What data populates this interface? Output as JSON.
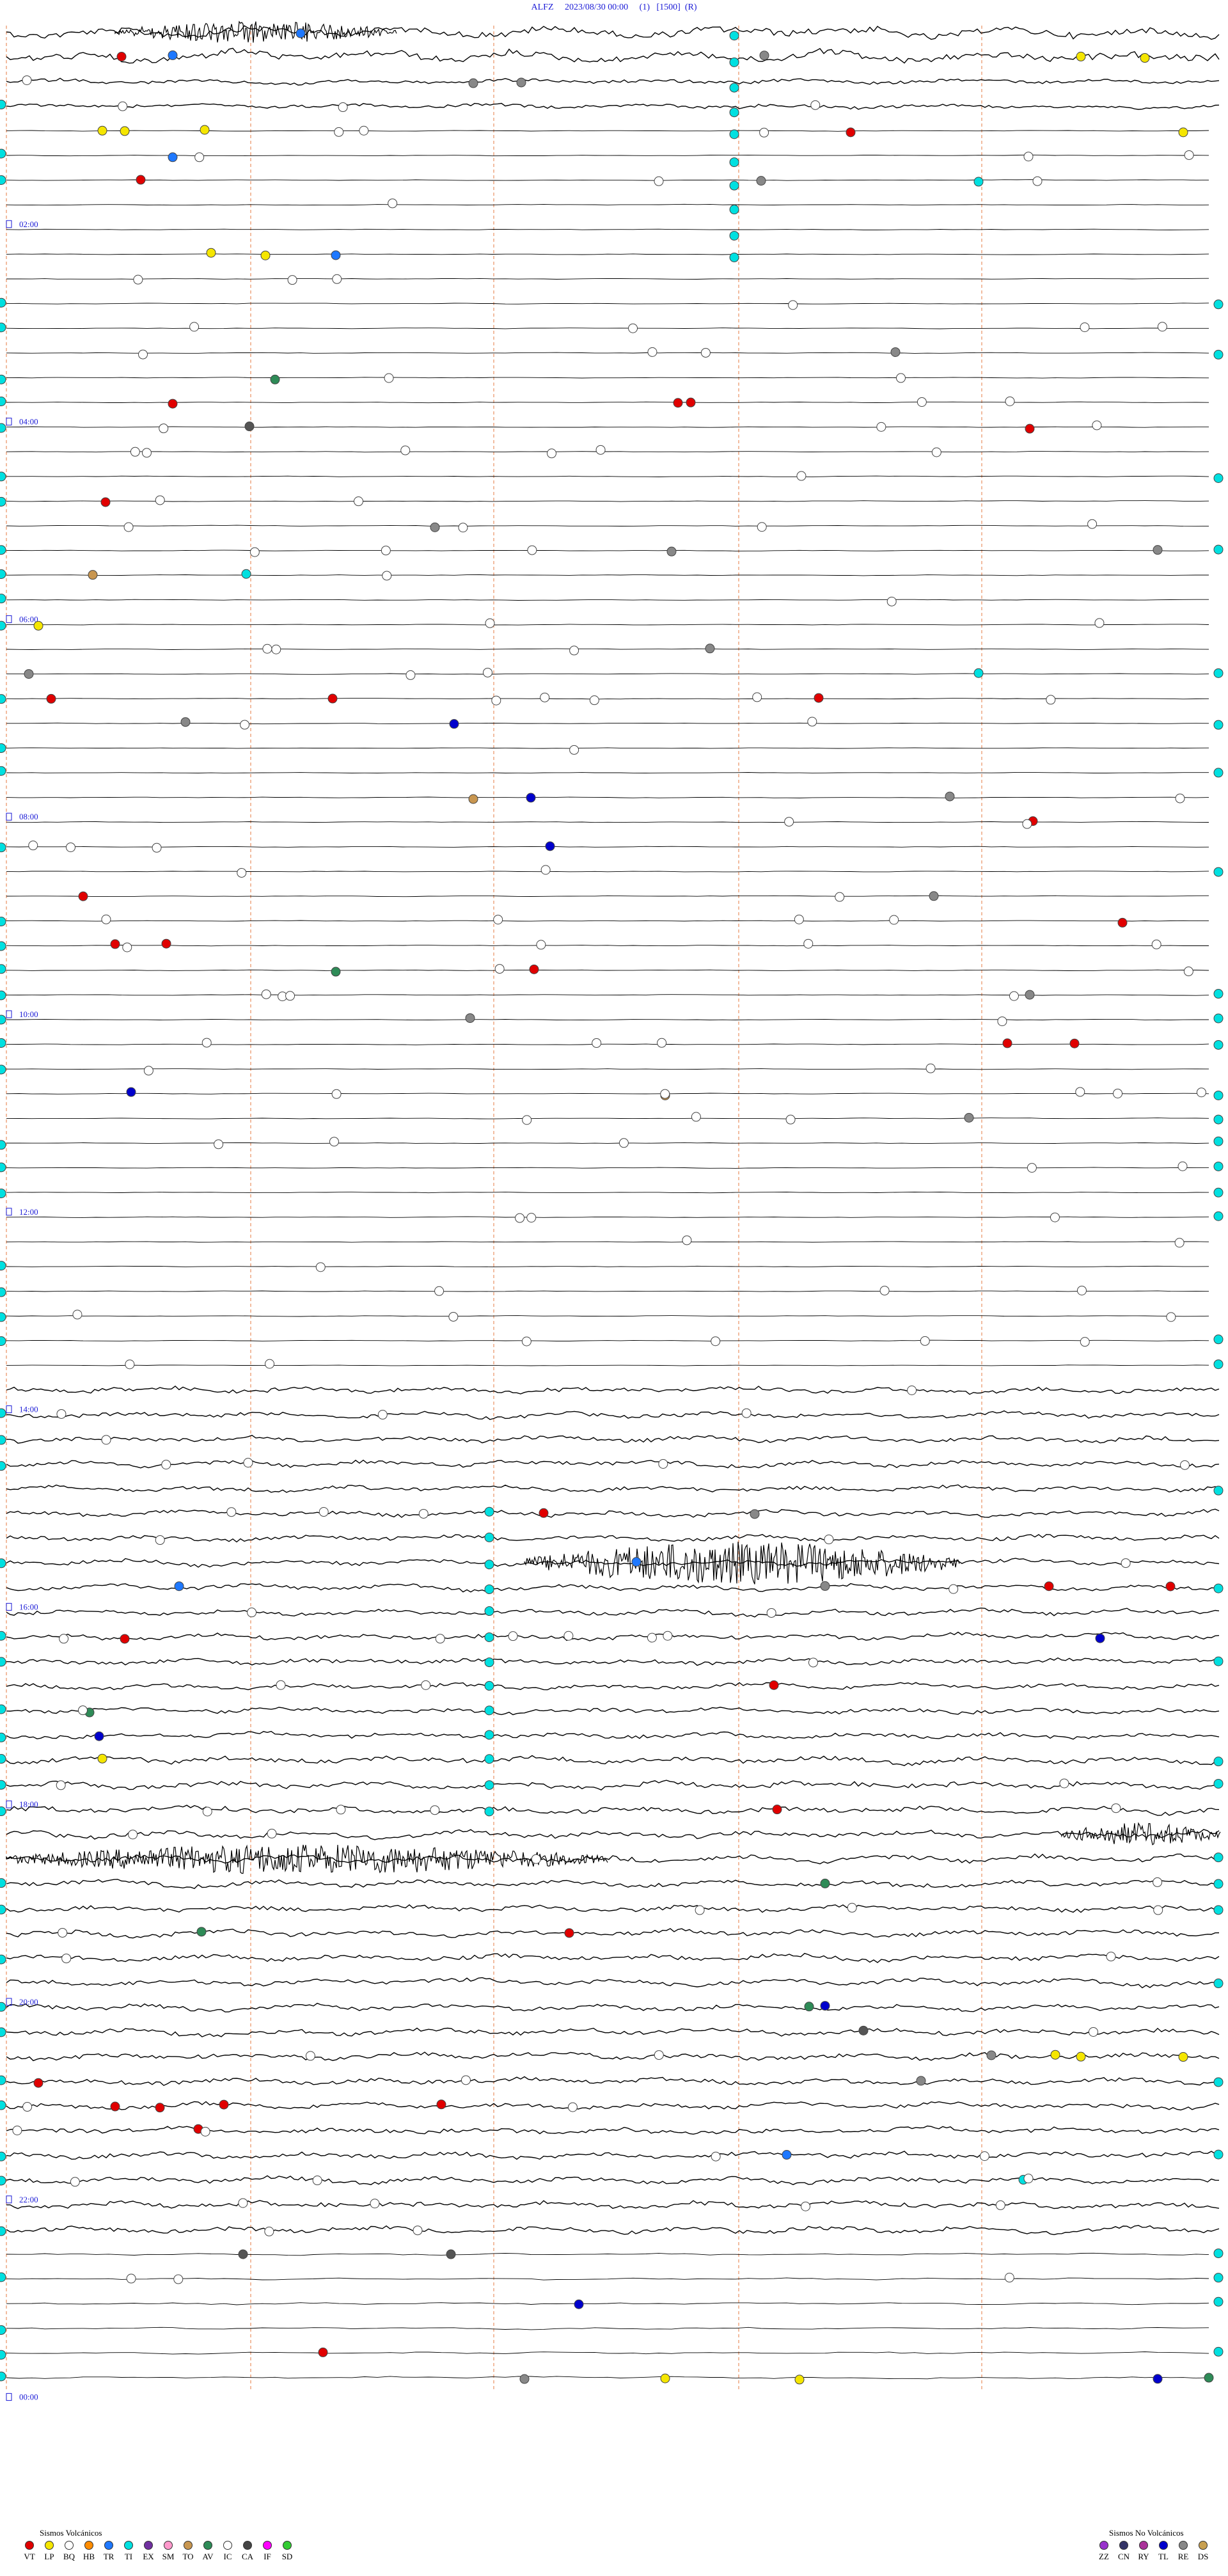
{
  "header": {
    "station": "ALFZ",
    "datetime": "2023/08/30 00:00",
    "channel": "(1)",
    "scale": "[1500]",
    "flag": "(R)"
  },
  "chart_data": {
    "type": "seismogram (helicorder)",
    "station": "ALFZ",
    "start": "2023/08/30 00:00",
    "hour_labels": [
      "02:00",
      "04:00",
      "06:00",
      "08:00",
      "10:00",
      "12:00",
      "14:00",
      "16:00",
      "18:00",
      "20:00",
      "22:00",
      "00:00"
    ],
    "trace_count": 96,
    "quiet_band": {
      "description": "nearly flat traces roughly 01:00–14:30"
    },
    "noisy_bands": [
      "00:00–01:00",
      "14:30–24:00"
    ],
    "event_colors": {
      "VT": "#e00000",
      "LP": "#f5e600",
      "BQ": "#ffffff",
      "HB": "#ff8c00",
      "TR": "#1e78ff",
      "TI": "#00e0e0",
      "EX": "#7030a0",
      "SM": "#ff99cc",
      "TO": "#c89650",
      "AV": "#2e8b57",
      "IC": "#ffffff",
      "CA": "#555555",
      "IF": "#ff00ff",
      "SD": "#33cc33",
      "ZZ": "#9933cc",
      "CN": "#333366",
      "RY": "#aa3399",
      "TL": "#0000cc",
      "RE": "#888888",
      "DS": "#c8a050"
    }
  },
  "legend": {
    "volcanic_title": "Sismos Volcánicos",
    "volcanic": [
      {
        "code": "VT",
        "color": "#e00000"
      },
      {
        "code": "LP",
        "color": "#f5e600"
      },
      {
        "code": "BQ",
        "color": "#ffffff"
      },
      {
        "code": "HB",
        "color": "#ff8c00"
      },
      {
        "code": "TR",
        "color": "#1e78ff"
      },
      {
        "code": "TI",
        "color": "#00e0e0"
      },
      {
        "code": "EX",
        "color": "#7030a0"
      },
      {
        "code": "SM",
        "color": "#ff99cc"
      },
      {
        "code": "TO",
        "color": "#c89650"
      },
      {
        "code": "AV",
        "color": "#2e8b57"
      },
      {
        "code": "IC",
        "color": "#ffffff"
      },
      {
        "code": "CA",
        "color": "#444444"
      },
      {
        "code": "IF",
        "color": "#ff00ff"
      },
      {
        "code": "SD",
        "color": "#33cc33"
      }
    ],
    "nonvolcanic_title": "Sismos No Volcánicos",
    "nonvolcanic": [
      {
        "code": "ZZ",
        "color": "#9933cc"
      },
      {
        "code": "CN",
        "color": "#333366"
      },
      {
        "code": "RY",
        "color": "#aa3399"
      },
      {
        "code": "TL",
        "color": "#0000cc"
      },
      {
        "code": "RE",
        "color": "#888888"
      },
      {
        "code": "DS",
        "color": "#c8a050"
      }
    ]
  }
}
